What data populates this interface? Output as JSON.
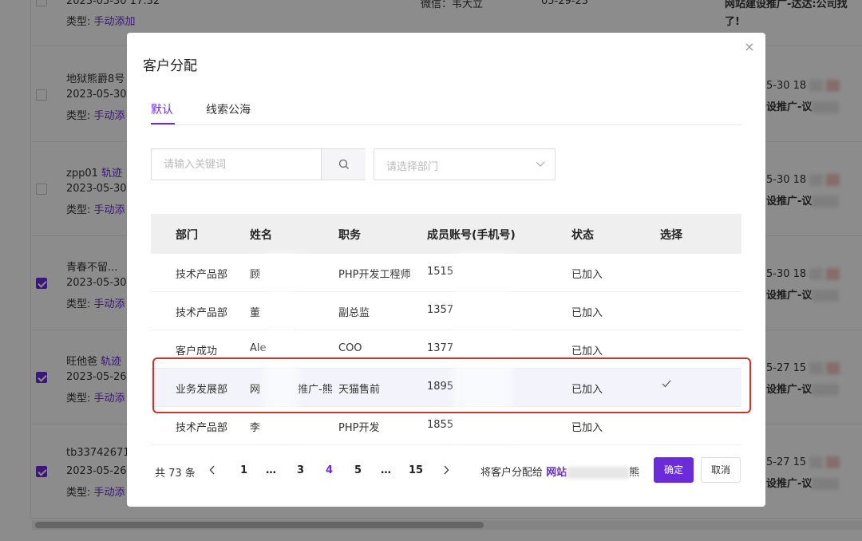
{
  "background": {
    "rows": [
      {
        "line1": "2023-05-30 17:32",
        "line2_label": "类型:",
        "line2_value": "手动添加",
        "checked": false
      },
      {
        "line1_name": "地狱熊爵8号",
        "line1_date": "2023-05-30",
        "line2_label": "类型:",
        "line2_value": "手动添",
        "checked": false,
        "right_date": "5-30 18",
        "right_text": "设推广-议"
      },
      {
        "line1_name": "zpp01",
        "line1_tag": "轨迹",
        "line1_date": "2023-05-30",
        "line2_label": "类型:",
        "line2_value": "手动添",
        "checked": false,
        "right_date": "5-30 18",
        "right_text": "设推广-议"
      },
      {
        "line1_name": "青春不留...",
        "line1_date": "2023-05-30",
        "line2_label": "类型:",
        "line2_value": "手动添",
        "checked": true,
        "right_date": "5-30 18",
        "right_text": "设推广-议"
      },
      {
        "line1_name": "旺他爸",
        "line1_tag": "轨迹",
        "line1_date": "2023-05-26",
        "line2_label": "类型:",
        "line2_value": "手动添",
        "checked": true,
        "right_date": "5-27 15",
        "right_text": "设推广-议"
      },
      {
        "line1_name": "tb33742671",
        "line1_date": "2023-05-26",
        "line2_label": "类型:",
        "line2_value": "手动添",
        "checked": true,
        "right_date": "5-27 15",
        "right_text": "设推广-议"
      }
    ],
    "top_mid1": "微信：韦大立",
    "top_mid2": "05-29-23",
    "top_right1": "网站建设推广-达达:公司找",
    "top_right2": "了!"
  },
  "modal": {
    "title": "客户分配",
    "close_glyph": "×",
    "tabs": [
      {
        "label": "默认",
        "active": true
      },
      {
        "label": "线索公海",
        "active": false
      }
    ],
    "search": {
      "placeholder": "请输入关键词",
      "value": ""
    },
    "dept_select": {
      "placeholder": "请选择部门"
    },
    "table": {
      "headers": [
        "部门",
        "姓名",
        "职务",
        "成员账号(手机号)",
        "状态",
        "选择"
      ],
      "rows": [
        {
          "dept": "技术产品部",
          "name": "顾",
          "title": "PHP开发工程师",
          "phone": "1515",
          "status": "已加入",
          "selected": false
        },
        {
          "dept": "技术产品部",
          "name": "董",
          "title": "副总监",
          "phone": "1357",
          "status": "已加入",
          "selected": false
        },
        {
          "dept": "客户成功",
          "name": "Ale",
          "title": "COO",
          "phone": "1377",
          "status": "已加入",
          "selected": false
        },
        {
          "dept": "业务发展部",
          "name": "网",
          "name_extra": "推广-熊",
          "title": "天猫售前",
          "phone": "1895",
          "status": "已加入",
          "selected": true
        },
        {
          "dept": "技术产品部",
          "name": "李",
          "title": "PHP开发",
          "phone": "1855",
          "status": "已加入",
          "selected": false
        }
      ]
    },
    "pagination": {
      "total": "共 73 条",
      "pages": [
        "1",
        "…",
        "3",
        "4",
        "5",
        "…",
        "15"
      ],
      "current": "4"
    },
    "assign": {
      "prefix": "将客户分配给",
      "target": "网站",
      "target_tail": "熊"
    },
    "ok_label": "确定",
    "cancel_label": "取消"
  },
  "colors": {
    "accent": "#6c2bd9",
    "highlight": "#c8362b"
  }
}
